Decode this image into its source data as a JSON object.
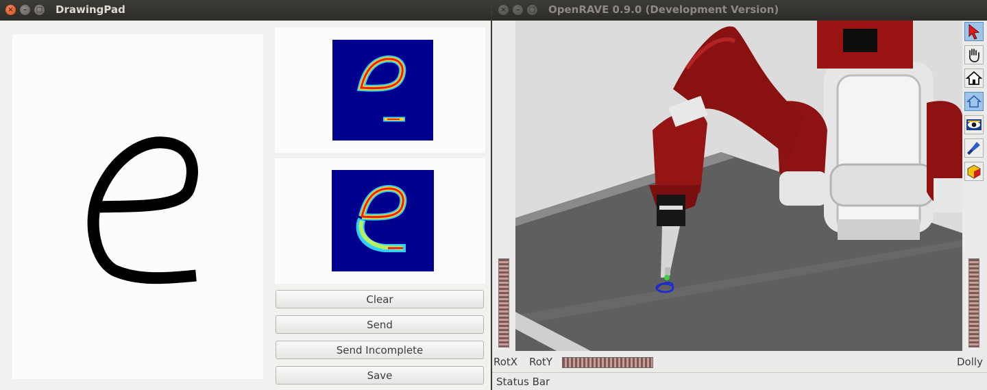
{
  "drawing_pad": {
    "title": "DrawingPad",
    "buttons": {
      "clear": "Clear",
      "send": "Send",
      "send_incomplete": "Send Incomplete",
      "save": "Save"
    }
  },
  "openrave": {
    "title": "OpenRAVE 0.9.0 (Development Version)",
    "toolbar_icons": [
      "select-arrow-icon",
      "hand-pan-icon",
      "home-view-icon",
      "view-all-icon",
      "eye-seek-icon",
      "flashlight-icon",
      "headlight-icon"
    ],
    "labels": {
      "rotx": "RotX",
      "roty": "RotY",
      "dolly": "Dolly"
    },
    "status_bar": "Status Bar"
  },
  "colors": {
    "titlebar": "#2c2b27",
    "close_button": "#e05a25",
    "robot_red": "#8e1212",
    "heatmap_bg": "#00008f",
    "trace_blue": "#1d2bd0"
  }
}
